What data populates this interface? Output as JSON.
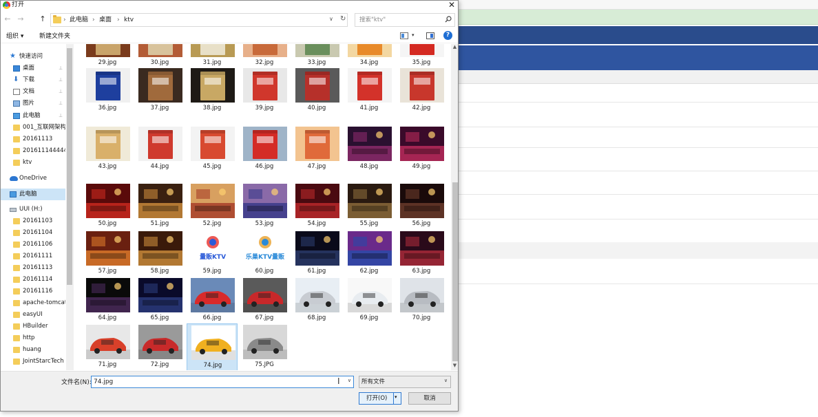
{
  "dialog": {
    "title": "打开",
    "close_glyph": "✕"
  },
  "nav": {
    "back": "←",
    "forward": "→",
    "up": "↑",
    "breadcrumb": [
      "此电脑",
      "桌面",
      "ktv"
    ],
    "separator": "›",
    "dropdown_glyph": "∨",
    "refresh_glyph": "↻",
    "search_placeholder": "搜索\"ktv\""
  },
  "toolbar": {
    "organize": "组织 ▾",
    "new_folder": "新建文件夹",
    "view_drop": "▾",
    "help": "?"
  },
  "sidebar": {
    "items": [
      {
        "label": "快速访问",
        "icon": "star-icon",
        "pinned": false
      },
      {
        "label": "桌面",
        "icon": "desktop-icon",
        "pinned": true
      },
      {
        "label": "下载",
        "icon": "download-icon",
        "pinned": true
      },
      {
        "label": "文档",
        "icon": "document-icon",
        "pinned": true
      },
      {
        "label": "图片",
        "icon": "pictures-icon",
        "pinned": true
      },
      {
        "label": "此电脑",
        "icon": "computer-icon",
        "pinned": true
      },
      {
        "label": "001_互联网架构",
        "icon": "folder-icon",
        "pinned": false
      },
      {
        "label": "20161113",
        "icon": "folder-icon",
        "pinned": false
      },
      {
        "label": "201611144444",
        "icon": "folder-icon",
        "pinned": false
      },
      {
        "label": "ktv",
        "icon": "folder-icon",
        "pinned": false
      },
      {
        "label": "OneDrive",
        "icon": "onedrive-icon",
        "pinned": false
      },
      {
        "label": "此电脑",
        "icon": "computer-icon",
        "pinned": false,
        "selected": true
      },
      {
        "label": "UUI (H:)",
        "icon": "drive-icon",
        "pinned": false
      },
      {
        "label": "20161103",
        "icon": "folder-icon",
        "pinned": false
      },
      {
        "label": "20161104",
        "icon": "folder-icon",
        "pinned": false
      },
      {
        "label": "20161106",
        "icon": "folder-icon",
        "pinned": false
      },
      {
        "label": "20161111",
        "icon": "folder-icon",
        "pinned": false
      },
      {
        "label": "20161113",
        "icon": "folder-icon",
        "pinned": false
      },
      {
        "label": "20161114",
        "icon": "folder-icon",
        "pinned": false
      },
      {
        "label": "20161116",
        "icon": "folder-icon",
        "pinned": false
      },
      {
        "label": "apache-tomcat",
        "icon": "folder-icon",
        "pinned": false
      },
      {
        "label": "easyUI",
        "icon": "folder-icon",
        "pinned": false
      },
      {
        "label": "HBuilder",
        "icon": "folder-icon",
        "pinned": false
      },
      {
        "label": "http",
        "icon": "folder-icon",
        "pinned": false
      },
      {
        "label": "huang",
        "icon": "folder-icon",
        "pinned": false
      },
      {
        "label": "JointStarcTech",
        "icon": "folder-icon",
        "pinned": false
      }
    ],
    "pin_glyph": "📌"
  },
  "files": [
    {
      "name": "29.jpg",
      "kind": "cigarette",
      "colors": [
        "#c9a46a",
        "#7a3b1c"
      ]
    },
    {
      "name": "30.jpg",
      "kind": "cigarette",
      "colors": [
        "#d8c39c",
        "#b35c36"
      ]
    },
    {
      "name": "31.jpg",
      "kind": "cigarette",
      "colors": [
        "#e8e0c8",
        "#b89a54"
      ]
    },
    {
      "name": "32.jpg",
      "kind": "cigarette",
      "colors": [
        "#c86a3a",
        "#e7b08a"
      ]
    },
    {
      "name": "33.jpg",
      "kind": "cigarette",
      "colors": [
        "#6a8f5c",
        "#c9c9b0"
      ]
    },
    {
      "name": "34.jpg",
      "kind": "cigarette",
      "colors": [
        "#e88a2a",
        "#f3d7a1"
      ]
    },
    {
      "name": "35.jpg",
      "kind": "cigarette",
      "colors": [
        "#d42a22",
        "#f5f5f5"
      ]
    },
    {
      "name": "36.jpg",
      "kind": "cigarette",
      "colors": [
        "#1e3f9e",
        "#f0f0f0"
      ]
    },
    {
      "name": "37.jpg",
      "kind": "cigarette",
      "colors": [
        "#a06a3c",
        "#3a2a20"
      ]
    },
    {
      "name": "38.jpg",
      "kind": "cigarette",
      "colors": [
        "#c8a864",
        "#1e1a16"
      ]
    },
    {
      "name": "39.jpg",
      "kind": "cigarette",
      "colors": [
        "#d0372c",
        "#e8e8e8"
      ]
    },
    {
      "name": "40.jpg",
      "kind": "cigarette",
      "colors": [
        "#b6302a",
        "#5a5a5a"
      ]
    },
    {
      "name": "41.jpg",
      "kind": "cigarette",
      "colors": [
        "#d3322a",
        "#f4f4f4"
      ]
    },
    {
      "name": "42.jpg",
      "kind": "cigarette",
      "colors": [
        "#c8372c",
        "#e9e3d8"
      ]
    },
    {
      "name": "43.jpg",
      "kind": "cigarette",
      "colors": [
        "#d9b06a",
        "#f0ead8"
      ]
    },
    {
      "name": "44.jpg",
      "kind": "cigarette",
      "colors": [
        "#cf3a2e",
        "#f2f2f2"
      ]
    },
    {
      "name": "45.jpg",
      "kind": "cigarette",
      "colors": [
        "#d84a30",
        "#f3f3f3"
      ]
    },
    {
      "name": "46.jpg",
      "kind": "cigarette",
      "colors": [
        "#d42c26",
        "#9fb4c8"
      ]
    },
    {
      "name": "47.jpg",
      "kind": "cigarette",
      "colors": [
        "#e06a3a",
        "#f3c490"
      ]
    },
    {
      "name": "48.jpg",
      "kind": "room",
      "colors": [
        "#8a2a6a",
        "#2a1030"
      ]
    },
    {
      "name": "49.jpg",
      "kind": "room",
      "colors": [
        "#b82a5a",
        "#3a0a2a"
      ]
    },
    {
      "name": "50.jpg",
      "kind": "room",
      "colors": [
        "#c8281e",
        "#5a0a0a"
      ]
    },
    {
      "name": "51.jpg",
      "kind": "room",
      "colors": [
        "#c8883a",
        "#3a2010"
      ]
    },
    {
      "name": "52.jpg",
      "kind": "room",
      "colors": [
        "#a8402a",
        "#d8a060"
      ]
    },
    {
      "name": "53.jpg",
      "kind": "room",
      "colors": [
        "#3a3a8a",
        "#8a6aa8"
      ]
    },
    {
      "name": "54.jpg",
      "kind": "room",
      "colors": [
        "#b8282a",
        "#4a0a10"
      ]
    },
    {
      "name": "55.jpg",
      "kind": "room",
      "colors": [
        "#8a6a3a",
        "#2a1a10"
      ]
    },
    {
      "name": "56.jpg",
      "kind": "room",
      "colors": [
        "#6a3a2a",
        "#1a0a0a"
      ]
    },
    {
      "name": "57.jpg",
      "kind": "room",
      "colors": [
        "#d8782a",
        "#6a2010"
      ]
    },
    {
      "name": "58.jpg",
      "kind": "room",
      "colors": [
        "#c88a3a",
        "#3a1a0a"
      ]
    },
    {
      "name": "59.jpg",
      "kind": "logo",
      "colors": [
        "#2a5ad8",
        "#e8302a"
      ],
      "logo_text": "量贩KTV"
    },
    {
      "name": "60.jpg",
      "kind": "logo",
      "colors": [
        "#2a8ad8",
        "#e8a02a"
      ],
      "logo_text": "乐巢KTV量贩"
    },
    {
      "name": "61.jpg",
      "kind": "room",
      "colors": [
        "#2a3a6a",
        "#0a0a1a"
      ]
    },
    {
      "name": "62.jpg",
      "kind": "room",
      "colors": [
        "#2a4aa8",
        "#6a2a8a"
      ]
    },
    {
      "name": "63.jpg",
      "kind": "room",
      "colors": [
        "#a82a3a",
        "#2a0a1a"
      ]
    },
    {
      "name": "64.jpg",
      "kind": "room",
      "colors": [
        "#4a2a5a",
        "#0a0a0a"
      ]
    },
    {
      "name": "65.jpg",
      "kind": "room",
      "colors": [
        "#2a3a7a",
        "#0a0a2a"
      ]
    },
    {
      "name": "66.jpg",
      "kind": "car",
      "colors": [
        "#d82a2a",
        "#6a8ab8"
      ]
    },
    {
      "name": "67.jpg",
      "kind": "car",
      "colors": [
        "#c8282a",
        "#5a5a5a"
      ]
    },
    {
      "name": "68.jpg",
      "kind": "car",
      "colors": [
        "#c8ccd2",
        "#e8eef4"
      ]
    },
    {
      "name": "69.jpg",
      "kind": "car",
      "colors": [
        "#e8ecf0",
        "#f8f8f8"
      ]
    },
    {
      "name": "70.jpg",
      "kind": "car",
      "colors": [
        "#b8bcc2",
        "#dfe3e8"
      ]
    },
    {
      "name": "71.jpg",
      "kind": "car",
      "colors": [
        "#d8402a",
        "#e8e8e8"
      ]
    },
    {
      "name": "72.jpg",
      "kind": "car",
      "colors": [
        "#c82a2a",
        "#9a9a9a"
      ]
    },
    {
      "name": "74.jpg",
      "kind": "car",
      "colors": [
        "#f0b020",
        "#ffffff"
      ],
      "selected": true
    },
    {
      "name": "75.JPG",
      "kind": "car",
      "colors": [
        "#8a8a8a",
        "#d8d8d8"
      ]
    }
  ],
  "bottom": {
    "filename_label": "文件名(N):",
    "filename_value": "74.jpg",
    "filetype_value": "所有文件",
    "drop_glyph": "∨",
    "open_label": "打开(O)",
    "open_split_glyph": "▾",
    "cancel_label": "取消",
    "ibeam": "I"
  },
  "scroll": {
    "up": "▲",
    "down": "▼"
  }
}
